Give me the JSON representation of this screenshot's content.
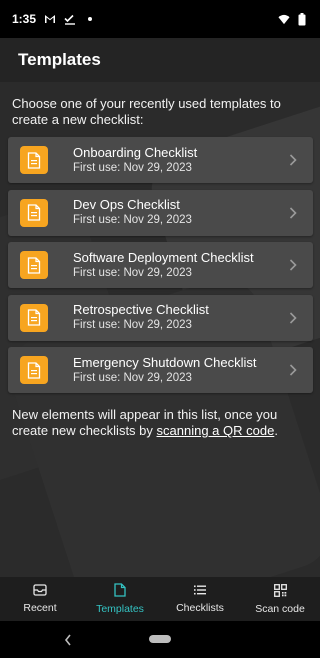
{
  "status_bar": {
    "time": "1:35",
    "icons_left": [
      "gmail-icon",
      "check-icon",
      "dot-icon"
    ],
    "icons_right": [
      "wifi-icon",
      "battery-icon"
    ]
  },
  "app_bar": {
    "title": "Templates"
  },
  "intro_text": "Choose one of your recently used templates to create a new checklist:",
  "templates": [
    {
      "title": "Onboarding Checklist",
      "subtitle": "First use: Nov 29, 2023"
    },
    {
      "title": "Dev Ops Checklist",
      "subtitle": "First use: Nov 29, 2023"
    },
    {
      "title": "Software Deployment Checklist",
      "subtitle": "First use: Nov 29, 2023"
    },
    {
      "title": "Retrospective Checklist",
      "subtitle": "First use: Nov 29, 2023"
    },
    {
      "title": "Emergency Shutdown Checklist",
      "subtitle": "First use: Nov 29, 2023"
    }
  ],
  "footer_note": {
    "before": "New elements will appear in this list, once you create new checklists by ",
    "link": "scanning a QR code",
    "after": "."
  },
  "bottom_nav": [
    {
      "label": "Recent",
      "icon": "inbox-icon",
      "active": false
    },
    {
      "label": "Templates",
      "icon": "document-icon",
      "active": true
    },
    {
      "label": "Checklists",
      "icon": "list-icon",
      "active": false
    },
    {
      "label": "Scan code",
      "icon": "qr-code-icon",
      "active": false
    }
  ],
  "colors": {
    "accent": "#34c3c3",
    "template_icon_bg": "#f7a520",
    "card_bg": "#4a4a4a",
    "content_bg": "#2b2b2b",
    "app_bar_bg": "#242424"
  }
}
